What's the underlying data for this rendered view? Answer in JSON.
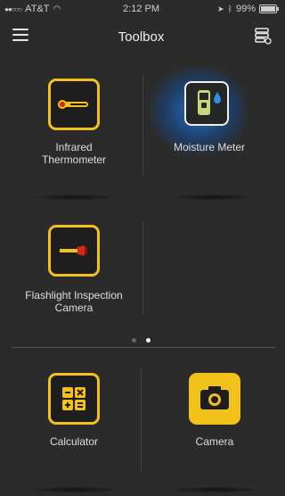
{
  "status_bar": {
    "carrier": "AT&T",
    "time": "2:12 PM",
    "battery": "99%"
  },
  "nav": {
    "title": "Toolbox",
    "menu_icon": "hamburger-menu-icon",
    "right_icon": "layers-settings-icon"
  },
  "tools": [
    {
      "label_line1": "Infrared",
      "label_line2": "Thermometer",
      "icon": "infrared-thermometer-icon"
    },
    {
      "label_line1": "Moisture Meter",
      "label_line2": "",
      "icon": "moisture-meter-icon",
      "selected": true
    },
    {
      "label_line1": "Flashlight Inspection",
      "label_line2": "Camera",
      "icon": "flashlight-icon"
    }
  ],
  "pager": {
    "pages": 2,
    "current": 2
  },
  "dock": [
    {
      "label": "Calculator",
      "icon": "calculator-icon"
    },
    {
      "label": "Camera",
      "icon": "camera-icon"
    }
  ],
  "colors": {
    "background": "#2b2b2b",
    "accent_yellow": "#f2c21b",
    "selected_glow": "#2878d2"
  }
}
